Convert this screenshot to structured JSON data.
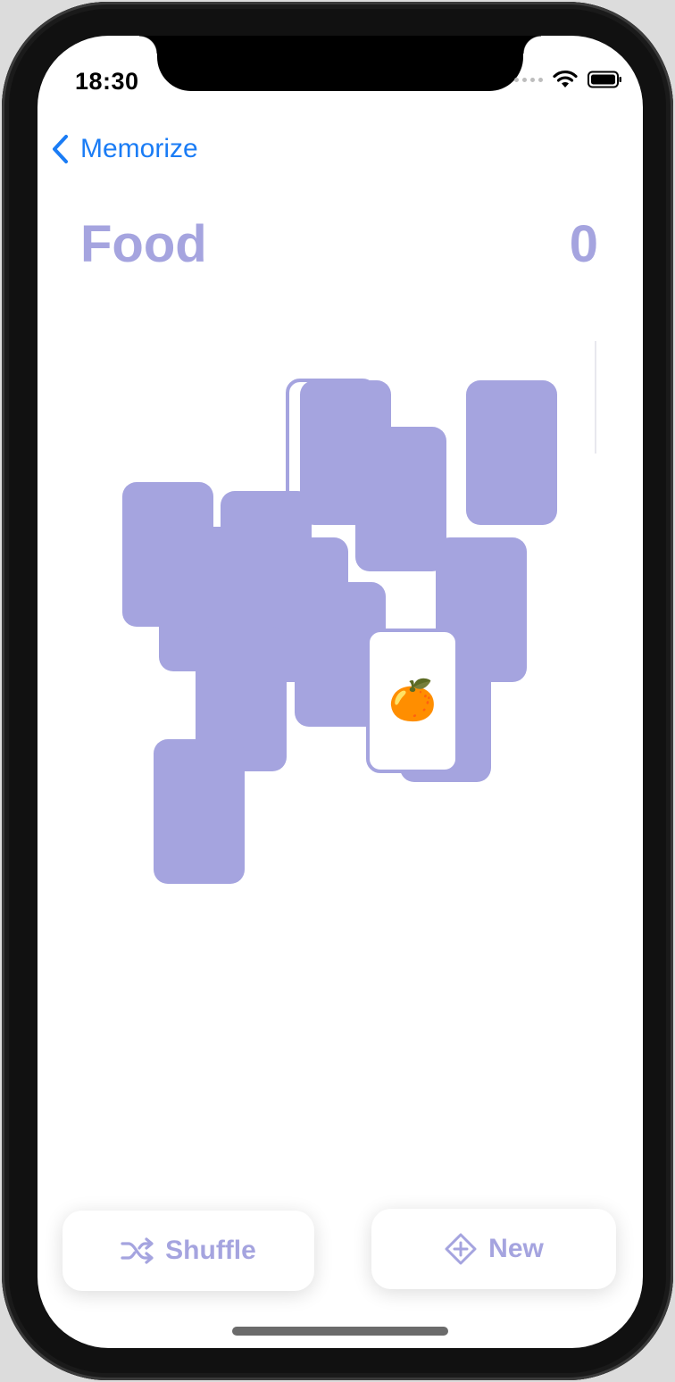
{
  "status_bar": {
    "time": "18:30",
    "icons": [
      "signal-dots-icon",
      "wifi-icon",
      "battery-icon"
    ]
  },
  "nav": {
    "back_label": "Memorize",
    "back_icon": "chevron-left-icon",
    "accent_color": "#1a7cf5"
  },
  "header": {
    "title": "Food",
    "score": "0"
  },
  "theme": {
    "card_color": "#a5a4df",
    "card_face_color": "#ffffff"
  },
  "cards": [
    {
      "face_up": false,
      "content": ""
    },
    {
      "face_up": false,
      "content": ""
    },
    {
      "face_up": false,
      "content": ""
    },
    {
      "face_up": false,
      "content": ""
    },
    {
      "face_up": false,
      "content": ""
    },
    {
      "face_up": false,
      "content": ""
    },
    {
      "face_up": false,
      "content": ""
    },
    {
      "face_up": false,
      "content": ""
    },
    {
      "face_up": false,
      "content": ""
    },
    {
      "face_up": false,
      "content": ""
    },
    {
      "face_up": false,
      "content": ""
    },
    {
      "face_up": true,
      "content": "🍊"
    },
    {
      "face_up": false,
      "content": ""
    }
  ],
  "toolbar": {
    "shuffle_label": "Shuffle",
    "shuffle_icon": "shuffle-icon",
    "new_label": "New",
    "new_icon": "plus-diamond-icon"
  }
}
